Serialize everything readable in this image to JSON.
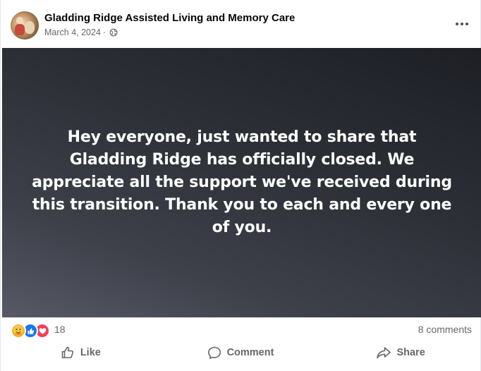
{
  "post": {
    "page_name": "Gladding Ridge Assisted Living and Memory Care",
    "date": "March 4, 2024",
    "separator": "·",
    "visibility_icon": "globe-icon",
    "more_icon": "more-options-icon",
    "media_text": "Hey everyone, just wanted to share that Gladding Ridge has officially closed. We appreciate all the support we've received during this transition. Thank you to each and every one of you."
  },
  "reactions": {
    "icons": [
      "care-icon",
      "like-icon",
      "love-icon"
    ],
    "count": "18",
    "comments": "8 comments"
  },
  "actions": {
    "like_label": "Like",
    "comment_label": "Comment",
    "share_label": "Share"
  },
  "colors": {
    "like_blue": "#1877f2",
    "love_red": "#f33e58",
    "care_yellow": "#f7b125",
    "secondary_text": "#65676b"
  }
}
